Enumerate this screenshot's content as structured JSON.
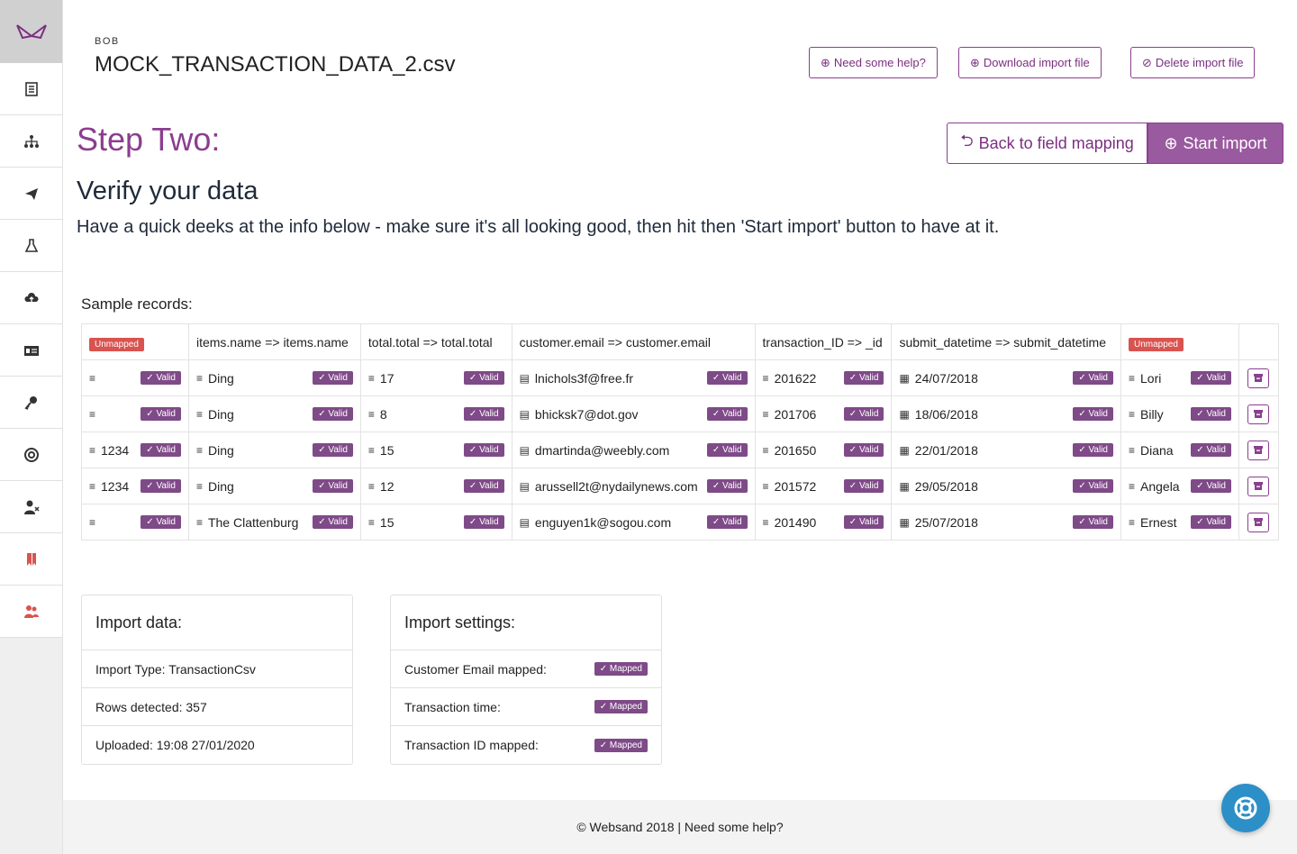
{
  "header": {
    "org": "BOB",
    "filename": "MOCK_TRANSACTION_DATA_2.csv",
    "help_label": "Need some help?",
    "download_label": "Download import file",
    "delete_label": "Delete import file"
  },
  "step": {
    "title": "Step Two:",
    "subtitle": "Verify your data",
    "description": "Have a quick deeks at the info below - make sure it's all looking good, then hit then 'Start import' button to have at it.",
    "back_label": "Back to field mapping",
    "start_label": "Start import"
  },
  "sample": {
    "label": "Sample records:",
    "unmapped_label": "Unmapped",
    "valid_label": "✓ Valid",
    "columns": [
      "Unmapped",
      "items.name => items.name",
      "total.total => total.total",
      "customer.email => customer.email",
      "transaction_ID => _id",
      "submit_datetime => submit_datetime",
      "Unmapped"
    ],
    "rows": [
      {
        "c0": "",
        "c1": "Ding",
        "c2": "17",
        "c3": "lnichols3f@free.fr",
        "c4": "201622",
        "c5": "24/07/2018",
        "c6": "Lori"
      },
      {
        "c0": "",
        "c1": "Ding",
        "c2": "8",
        "c3": "bhicksk7@dot.gov",
        "c4": "201706",
        "c5": "18/06/2018",
        "c6": "Billy"
      },
      {
        "c0": "1234",
        "c1": "Ding",
        "c2": "15",
        "c3": "dmartinda@weebly.com",
        "c4": "201650",
        "c5": "22/01/2018",
        "c6": "Diana"
      },
      {
        "c0": "1234",
        "c1": "Ding",
        "c2": "12",
        "c3": "arussell2t@nydailynews.com",
        "c4": "201572",
        "c5": "29/05/2018",
        "c6": "Angela"
      },
      {
        "c0": "",
        "c1": "The Clattenburg",
        "c2": "15",
        "c3": "enguyen1k@sogou.com",
        "c4": "201490",
        "c5": "25/07/2018",
        "c6": "Ernest"
      }
    ]
  },
  "import_data": {
    "title": "Import data:",
    "type": "Import Type: TransactionCsv",
    "rows": "Rows detected: 357",
    "uploaded": "Uploaded: 19:08 27/01/2020"
  },
  "import_settings": {
    "title": "Import settings:",
    "mapped_label": "✓ Mapped",
    "items": [
      "Customer Email mapped:",
      "Transaction time:",
      "Transaction ID mapped:"
    ]
  },
  "footer": {
    "text": "© Websand 2018 | Need some help?"
  },
  "colors": {
    "accent": "#8b3e8f",
    "badge": "#7f4a88",
    "danger": "#d9534f",
    "fab": "#2d8fc7"
  },
  "icons": {
    "sidebar": [
      "logo-icon",
      "list-icon",
      "hierarchy-icon",
      "send-icon",
      "flask-icon",
      "cloud-upload-icon",
      "id-card-icon",
      "key-icon",
      "lifebuoy-icon",
      "user-remove-icon",
      "bookmark-icon",
      "users-icon"
    ]
  }
}
